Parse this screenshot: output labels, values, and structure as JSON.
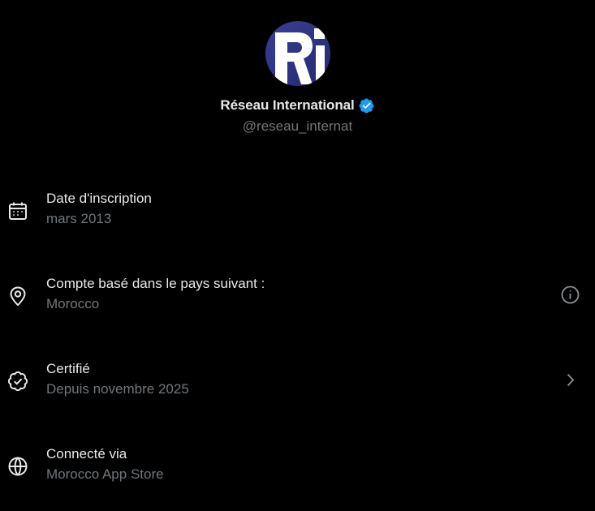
{
  "profile": {
    "avatar_icon": "reseau-international-logo",
    "avatar_text": "RI",
    "name": "Réseau International",
    "verified_icon": "verified-badge-icon",
    "verified_color": "#1d9bf0",
    "handle": "@reseau_internat"
  },
  "info_rows": [
    {
      "icon": "calendar-icon",
      "label": "Date d'inscription",
      "value": "mars 2013"
    },
    {
      "icon": "location-pin-icon",
      "label": "Compte basé dans le pays suivant :",
      "value": "Morocco",
      "trailing_icon": "info-icon"
    },
    {
      "icon": "verified-outline-icon",
      "label": "Certifié",
      "value": "Depuis novembre 2025",
      "trailing_icon": "chevron-right-icon"
    },
    {
      "icon": "globe-icon",
      "label": "Connecté via",
      "value": "Morocco App Store"
    }
  ],
  "colors": {
    "background": "#000000",
    "primary_text": "#e7e9ea",
    "secondary_text": "#71767b",
    "accent": "#1d9bf0",
    "avatar_bg": "#2d3584"
  }
}
